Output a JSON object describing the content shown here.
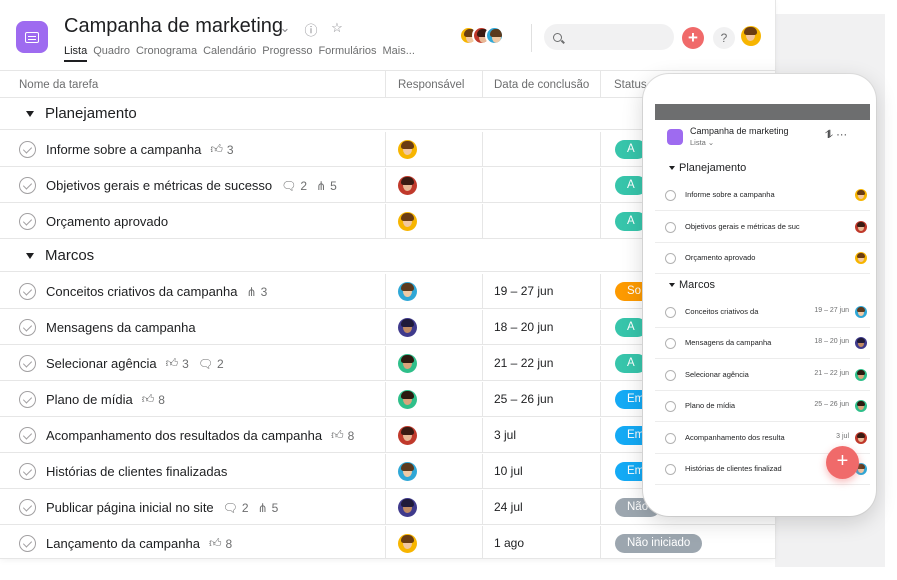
{
  "project": {
    "title": "Campanha de marketing",
    "tabs": [
      "Lista",
      "Quadro",
      "Cronograma",
      "Calendário",
      "Progresso",
      "Formulários",
      "Mais..."
    ],
    "active_tab": "Lista",
    "accent_color": "#9e6bf0"
  },
  "toolbar": {
    "icons": [
      "chevron-down-icon",
      "info-icon",
      "star-icon",
      "search-icon",
      "plus-icon",
      "help-icon"
    ],
    "help_label": "?",
    "plus_label": "+"
  },
  "columns": [
    "Nome da tarefa",
    "Responsável",
    "Data de conclusão",
    "Status"
  ],
  "sections": [
    {
      "name": "Planejamento",
      "tasks": [
        {
          "name": "Informe sobre a campanha",
          "likes": "3",
          "comments": "",
          "subtasks": "",
          "date": "",
          "status": "A",
          "status_color": "#37c5ab",
          "avatar": "a1"
        },
        {
          "name": "Objetivos gerais e métricas de sucesso",
          "likes": "",
          "comments": "2",
          "subtasks": "5",
          "date": "",
          "status": "A",
          "status_color": "#37c5ab",
          "avatar": "a2"
        },
        {
          "name": "Orçamento aprovado",
          "likes": "",
          "comments": "",
          "subtasks": "",
          "date": "",
          "status": "A",
          "status_color": "#37c5ab",
          "avatar": "a1"
        }
      ]
    },
    {
      "name": "Marcos",
      "tasks": [
        {
          "name": "Conceitos criativos da campanha",
          "likes": "",
          "comments": "",
          "subtasks": "3",
          "date": "19 – 27 jun",
          "status": "So",
          "status_color": "#fd9a00",
          "avatar": "a3"
        },
        {
          "name": "Mensagens da campanha",
          "likes": "",
          "comments": "",
          "subtasks": "",
          "date": "18 – 20 jun",
          "status": "A",
          "status_color": "#37c5ab",
          "avatar": "a4"
        },
        {
          "name": "Selecionar agência",
          "likes": "3",
          "comments": "2",
          "subtasks": "",
          "date": "21 – 22 jun",
          "status": "A",
          "status_color": "#37c5ab",
          "avatar": "a5"
        },
        {
          "name": "Plano de mídia",
          "likes": "8",
          "comments": "",
          "subtasks": "",
          "date": "25 – 26 jun",
          "status": "Em a",
          "status_color": "#14aaf5",
          "avatar": "a5"
        },
        {
          "name": "Acompanhamento dos resultados da campanha",
          "likes": "8",
          "comments": "",
          "subtasks": "",
          "date": "3 jul",
          "status": "Em a",
          "status_color": "#14aaf5",
          "avatar": "a2"
        },
        {
          "name": "Histórias de clientes finalizadas",
          "likes": "",
          "comments": "",
          "subtasks": "",
          "date": "10 jul",
          "status": "Em a",
          "status_color": "#14aaf5",
          "avatar": "a3"
        },
        {
          "name": "Publicar página inicial no site",
          "likes": "",
          "comments": "2",
          "subtasks": "5",
          "date": "24 jul",
          "status": "Não",
          "status_color": "#9ca6af",
          "avatar": "a4"
        },
        {
          "name": "Lançamento da campanha",
          "likes": "8",
          "comments": "",
          "subtasks": "",
          "date": "1 ago",
          "status": "Não iniciado",
          "status_color": "#9ca6af",
          "avatar": "a1"
        }
      ]
    }
  ],
  "mobile": {
    "title": "Campanha de marketing",
    "view_label": "Lista",
    "sections": [
      {
        "name": "Planejamento",
        "rows": [
          {
            "name": "Informe sobre a campanha",
            "date": "",
            "avatar": "a1"
          },
          {
            "name": "Objetivos gerais e métricas de suc",
            "date": "",
            "avatar": "a2"
          },
          {
            "name": "Orçamento aprovado",
            "date": "",
            "avatar": "a1"
          }
        ]
      },
      {
        "name": "Marcos",
        "rows": [
          {
            "name": "Conceitos criativos da",
            "date": "19 – 27 jun",
            "avatar": "a3"
          },
          {
            "name": "Mensagens da campanha",
            "date": "18 – 20 jun",
            "avatar": "a4"
          },
          {
            "name": "Selecionar agência",
            "date": "21 – 22 jun",
            "avatar": "a5"
          },
          {
            "name": "Plano de mídia",
            "date": "25 – 26 jun",
            "avatar": "a5"
          },
          {
            "name": "Acompanhamento dos resulta",
            "date": "3 jul",
            "avatar": "a2"
          },
          {
            "name": "Histórias de clientes finalizad",
            "date": "10 jul",
            "avatar": "a3"
          }
        ]
      }
    ],
    "fab_label": "+"
  },
  "avatar_colors": {
    "a1": {
      "bg": "#f7b500",
      "hair": "#6b3d12",
      "face": "#f2c7a0"
    },
    "a2": {
      "bg": "#c0392b",
      "hair": "#3a1a12",
      "face": "#e8b896"
    },
    "a3": {
      "bg": "#2fa7d6",
      "hair": "#5b3a1e",
      "face": "#f0c9a5"
    },
    "a4": {
      "bg": "#3f3a8c",
      "hair": "#1f1a3a",
      "face": "#c08a62"
    },
    "a5": {
      "bg": "#2fbf8a",
      "hair": "#2d1a10",
      "face": "#d9a47c"
    }
  }
}
